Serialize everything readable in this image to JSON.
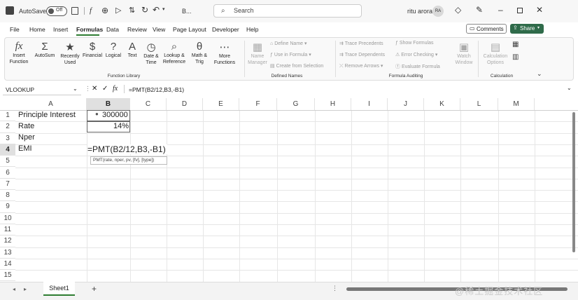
{
  "titlebar": {
    "autosave_label": "AutoSave",
    "toggle_state": "Off",
    "file_name": "B...",
    "search_placeholder": "Search",
    "user_name": "ritu arora",
    "user_initials": "RA"
  },
  "menu": {
    "tabs": [
      "File",
      "Home",
      "Insert",
      "Formulas",
      "Data",
      "Review",
      "View",
      "Page Layout",
      "Developer",
      "Help"
    ],
    "active_tab": "Formulas",
    "comments_label": "Comments",
    "share_label": "Share"
  },
  "ribbon": {
    "function_library": {
      "group_label": "Function Library",
      "buttons": [
        {
          "l1": "Insert",
          "l2": "Function",
          "icon": "fx-icon",
          "glyph": "fx"
        },
        {
          "l1": "AutoSum",
          "l2": "",
          "icon": "sigma-icon",
          "glyph": "Σ"
        },
        {
          "l1": "Recently",
          "l2": "Used",
          "icon": "star-book-icon",
          "glyph": "★"
        },
        {
          "l1": "Financial",
          "l2": "",
          "icon": "financial-book-icon",
          "glyph": "$"
        },
        {
          "l1": "Logical",
          "l2": "",
          "icon": "logical-book-icon",
          "glyph": "?"
        },
        {
          "l1": "Text",
          "l2": "",
          "icon": "text-book-icon",
          "glyph": "A"
        },
        {
          "l1": "Date &",
          "l2": "Time",
          "icon": "date-time-book-icon",
          "glyph": "◷"
        },
        {
          "l1": "Lookup &",
          "l2": "Reference",
          "icon": "lookup-book-icon",
          "glyph": "⌕"
        },
        {
          "l1": "Math &",
          "l2": "Trig",
          "icon": "math-trig-book-icon",
          "glyph": "θ"
        },
        {
          "l1": "More",
          "l2": "Functions",
          "icon": "more-functions-book-icon",
          "glyph": "⋯"
        }
      ]
    },
    "defined_names": {
      "group_label": "Defined Names",
      "name_manager": {
        "l1": "Name",
        "l2": "Manager"
      },
      "define_name": "Define Name",
      "use_in_formula": "Use in Formula",
      "create_from_selection": "Create from Selection"
    },
    "formula_auditing": {
      "group_label": "Formula Auditing",
      "trace_precedents": "Trace Precedents",
      "trace_dependents": "Trace Dependents",
      "remove_arrows": "Remove Arrows",
      "show_formulas": "Show Formulas",
      "error_checking": "Error Checking",
      "evaluate_formula": "Evaluate Formula",
      "watch_window": {
        "l1": "Watch",
        "l2": "Window"
      }
    },
    "calculation": {
      "group_label": "Calculation",
      "calculation_options": {
        "l1": "Calculation",
        "l2": "Options"
      }
    }
  },
  "formula_bar": {
    "name_box": "VLOOKUP",
    "formula": "=PMT(B2/12,B3,-B1)"
  },
  "grid": {
    "columns": [
      "A",
      "B",
      "C",
      "D",
      "E",
      "F",
      "G",
      "H",
      "I",
      "J",
      "K",
      "L",
      "M"
    ],
    "rows": [
      "1",
      "2",
      "3",
      "4",
      "5",
      "6",
      "7",
      "8",
      "9",
      "10",
      "11",
      "12",
      "13",
      "14",
      "15"
    ],
    "cells": {
      "A1": "Principle Interest",
      "B1": "300000",
      "A2": "Rate",
      "B2": "14%",
      "A3": "Nper",
      "A4": "EMI",
      "B4": "=PMT(B2/12,B3,-B1)"
    },
    "tooltip": "PMT(rate, nper, pv, [fv], [type])"
  },
  "sheets": {
    "tabs": [
      "Sheet1"
    ],
    "add_label": "+"
  },
  "watermark": "@稀土掘金技术社区"
}
